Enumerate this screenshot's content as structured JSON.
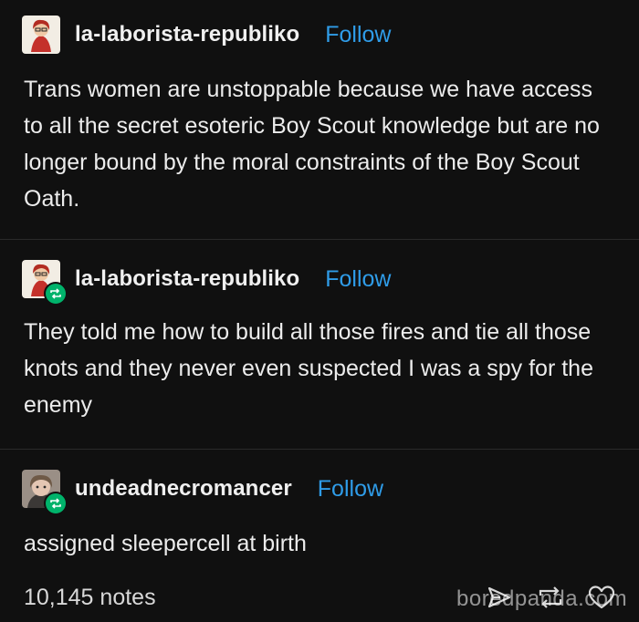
{
  "posts": [
    {
      "username": "la-laborista-republiko",
      "follow_label": "Follow",
      "text": "Trans women are unstoppable because we have access to all the secret esoteric Boy Scout knowledge but are no longer bound by the moral constraints of the Boy Scout Oath.",
      "is_reblog": false
    },
    {
      "username": "la-laborista-republiko",
      "follow_label": "Follow",
      "text": "They told me how to build all those fires and tie all those knots and they never even suspected I was a spy for the enemy",
      "is_reblog": true
    },
    {
      "username": "undeadnecromancer",
      "follow_label": "Follow",
      "text": "assigned sleepercell at birth",
      "is_reblog": true
    }
  ],
  "footer": {
    "notes": "10,145 notes",
    "actions": [
      "share-icon",
      "reblog-icon",
      "heart-icon"
    ]
  },
  "watermark": "boredpanda.com",
  "colors": {
    "background": "#101010",
    "text": "#ececec",
    "follow": "#2f9ce8",
    "reblog_badge": "#00b36b"
  }
}
